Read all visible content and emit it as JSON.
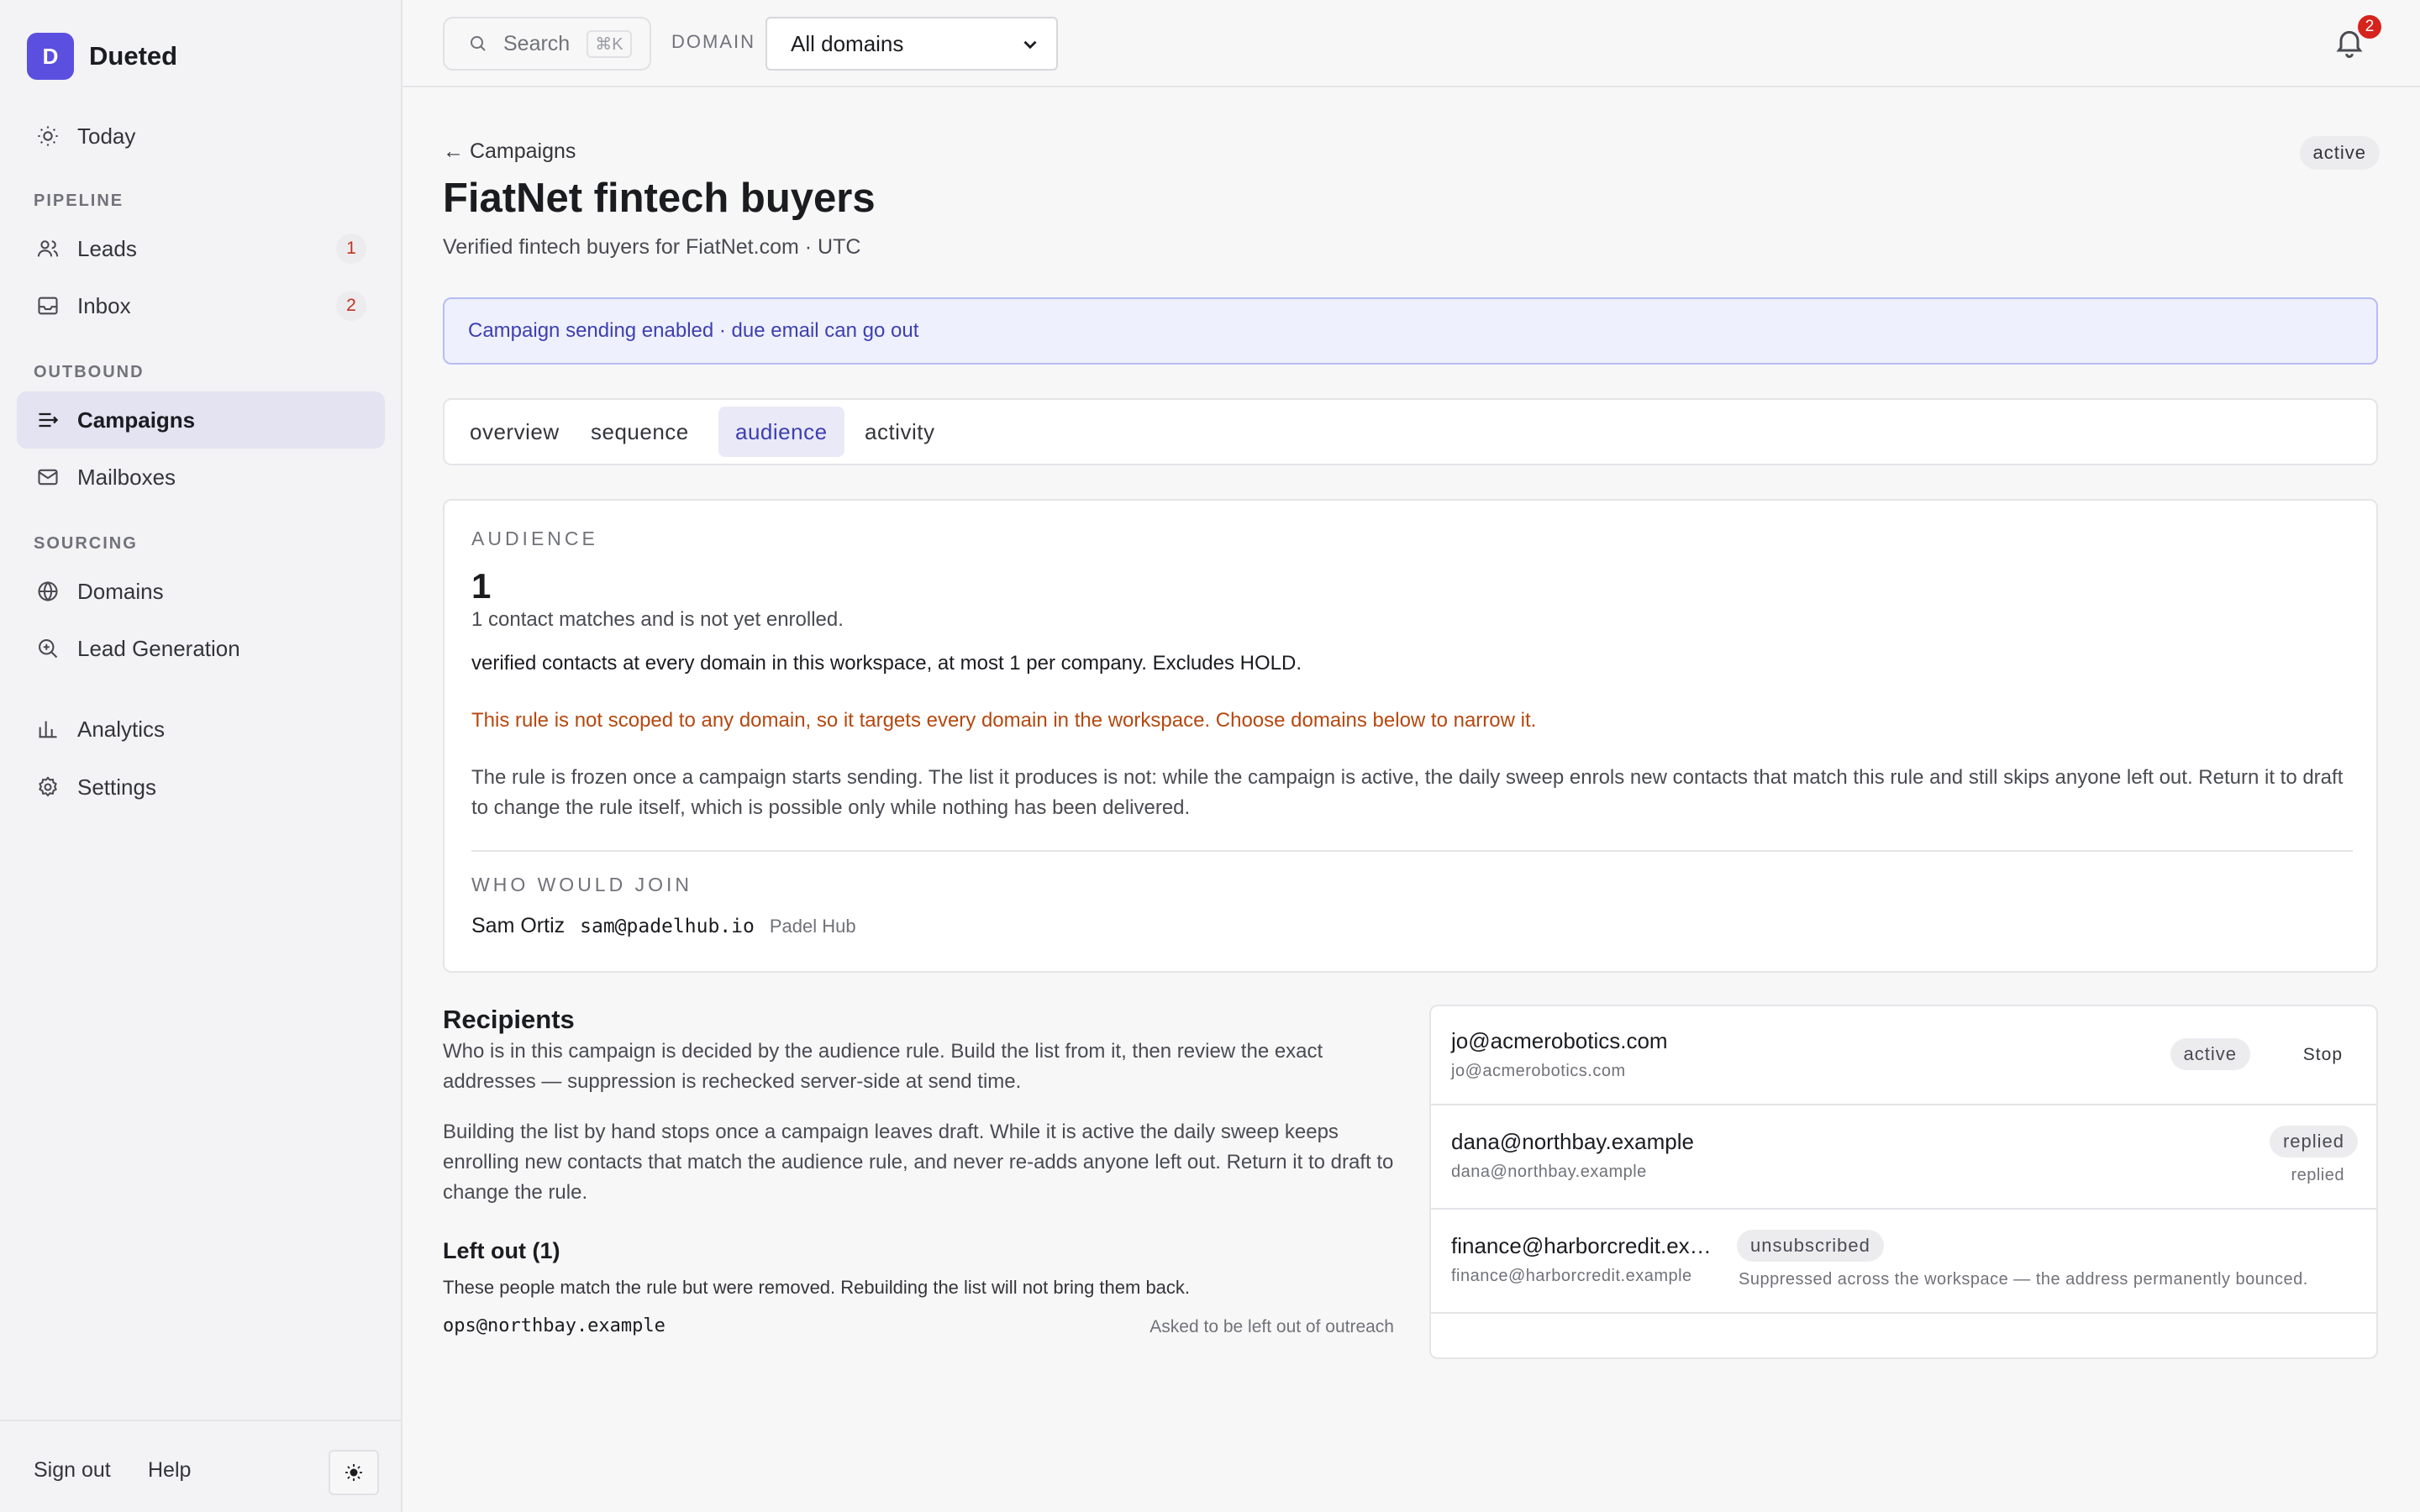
{
  "app": {
    "brand_initial": "D",
    "brand_name": "Dueted"
  },
  "sidebar": {
    "today": "Today",
    "pipeline_label": "PIPELINE",
    "leads": {
      "label": "Leads",
      "badge": "1"
    },
    "inbox": {
      "label": "Inbox",
      "badge": "2"
    },
    "outbound_label": "OUTBOUND",
    "campaigns": "Campaigns",
    "mailboxes": "Mailboxes",
    "sourcing_label": "SOURCING",
    "domains": "Domains",
    "lead_generation": "Lead Generation",
    "analytics": "Analytics",
    "settings": "Settings",
    "sign_out": "Sign out",
    "help": "Help"
  },
  "topbar": {
    "search_placeholder": "Search",
    "search_shortcut": "⌘K",
    "domain_label": "DOMAIN",
    "domain_selected": "All domains",
    "notification_count": "2"
  },
  "campaign": {
    "back_label": "← Campaigns",
    "status": "active",
    "title": "FiatNet fintech buyers",
    "subtitle": "Verified fintech buyers for FiatNet.com · UTC",
    "notice": "Campaign sending enabled · due email can go out"
  },
  "tabs": [
    {
      "label": "overview"
    },
    {
      "label": "sequence"
    },
    {
      "label": "audience",
      "active": true
    },
    {
      "label": "activity"
    }
  ],
  "audience": {
    "eyebrow": "AUDIENCE",
    "count": "1",
    "count_note": "1 contact matches and is not yet enrolled.",
    "rule": "verified contacts at every domain in this workspace, at most 1 per company. Excludes HOLD.",
    "warning": "This rule is not scoped to any domain, so it targets every domain in the workspace. Choose domains below to narrow it.",
    "frozen_note": "The rule is frozen once a campaign starts sending. The list it produces is not: while the campaign is active, the daily sweep enrols new contacts that match this rule and still skips anyone left out. Return it to draft to change the rule itself, which is possible only while nothing has been delivered.",
    "who_label": "WHO WOULD JOIN",
    "who": {
      "name": "Sam Ortiz",
      "email": "sam@padelhub.io",
      "company": "Padel Hub"
    }
  },
  "recipients": {
    "title": "Recipients",
    "desc": "Who is in this campaign is decided by the audience rule. Build the list from it, then review the exact addresses — suppression is rechecked server-side at send time.",
    "desc2": "Building the list by hand stops once a campaign leaves draft. While it is active the daily sweep keeps enrolling new contacts that match the audience rule, and never re-adds anyone left out. Return it to draft to change the rule.",
    "left_out_title": "Left out (1)",
    "left_out_note": "These people match the rule but were removed. Rebuilding the list will not bring them back.",
    "left_out_email": "ops@northbay.example",
    "left_out_reason": "Asked to be left out of outreach",
    "rows": [
      {
        "email": "jo@acmerobotics.com",
        "sub": "jo@acmerobotics.com",
        "status": "active",
        "action": "Stop"
      },
      {
        "email": "dana@northbay.example",
        "sub": "dana@northbay.example",
        "status": "replied",
        "note": "replied"
      },
      {
        "email": "finance@harborcredit.ex…",
        "sub": "finance@harborcredit.example",
        "status": "unsubscribed",
        "note": "Suppressed across the workspace — the address permanently bounced."
      }
    ]
  },
  "colors": {
    "accent": "#5b4fe0",
    "notice_bg": "#eef0fd",
    "warning": "#b5480f",
    "badge_red": "#d6241d"
  }
}
